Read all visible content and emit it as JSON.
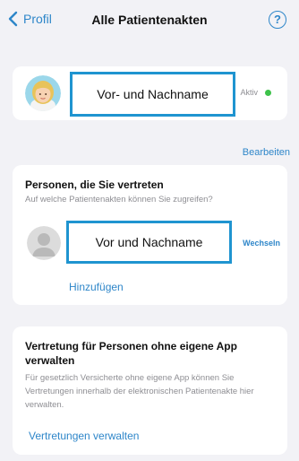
{
  "nav": {
    "back_label": "Profil",
    "title": "Alle Patientenakten",
    "help_symbol": "?"
  },
  "own_record": {
    "name": "Vor- und Nachname",
    "status": "Aktiv",
    "status_color": "#3ec24a"
  },
  "edit_label": "Bearbeiten",
  "represented": {
    "title": "Personen, die Sie vertreten",
    "subtitle": "Auf welche Patientenakten können Sie zugreifen?",
    "person_name": "Vor und Nachname",
    "switch_label": "Wechseln",
    "add_label": "Hinzufügen"
  },
  "no_app": {
    "title": "Vertretung für Personen ohne eigene App verwalten",
    "description": "Für gesetzlich Versicherte ohne eigene App können Sie Vertretungen innerhalb der elektronischen Patientenakte hier verwalten.",
    "manage_label": "Vertretungen verwalten"
  },
  "colors": {
    "accent": "#2e86c9",
    "highlight_border": "#1f94d0",
    "background": "#f2f2f6"
  }
}
